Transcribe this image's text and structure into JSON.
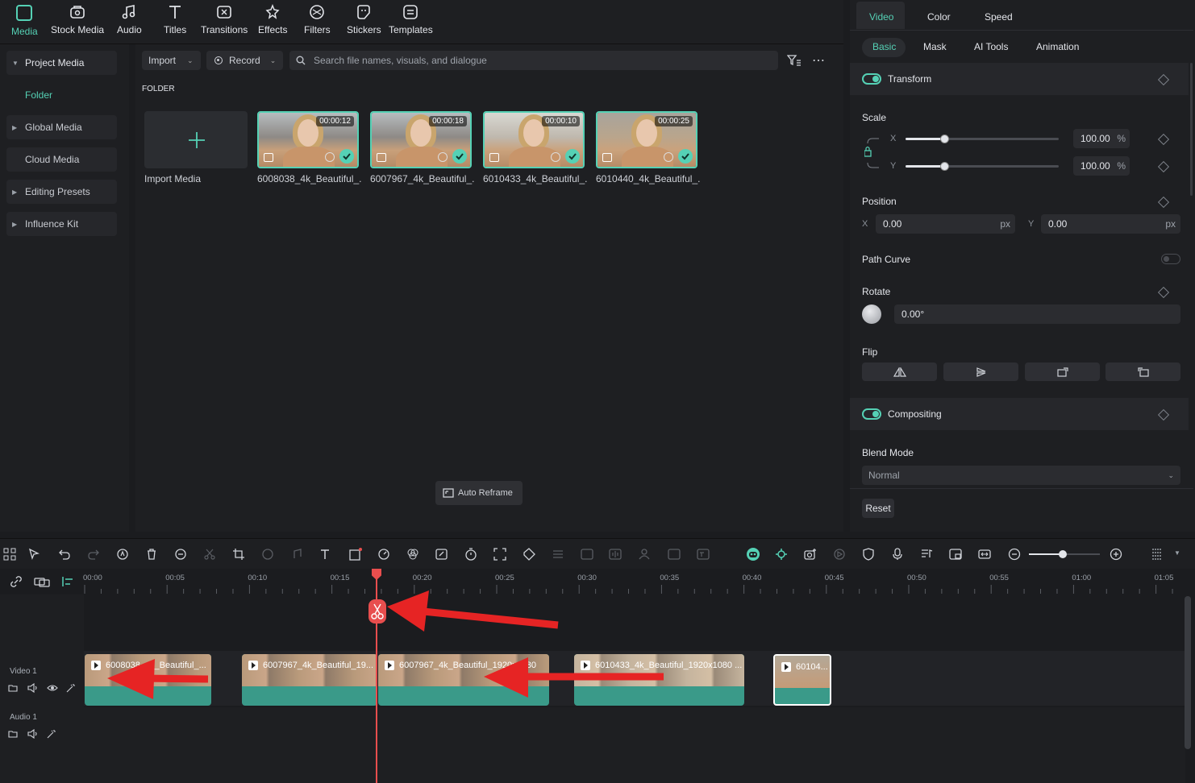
{
  "topbar": {
    "items": [
      {
        "label": "Media",
        "icon": "media-icon",
        "active": true
      },
      {
        "label": "Stock Media",
        "icon": "stock-media-icon"
      },
      {
        "label": "Audio",
        "icon": "music-note-icon"
      },
      {
        "label": "Titles",
        "icon": "text-t-icon"
      },
      {
        "label": "Transitions",
        "icon": "transitions-icon"
      },
      {
        "label": "Effects",
        "icon": "effects-icon"
      },
      {
        "label": "Filters",
        "icon": "filters-icon"
      },
      {
        "label": "Stickers",
        "icon": "stickers-icon"
      },
      {
        "label": "Templates",
        "icon": "templates-icon"
      }
    ]
  },
  "sidebar": {
    "items": [
      {
        "label": "Project Media",
        "expanded": true
      },
      {
        "label": "Folder"
      },
      {
        "label": "Global Media"
      },
      {
        "label": "Cloud Media"
      },
      {
        "label": "Editing Presets"
      },
      {
        "label": "Influence Kit"
      }
    ]
  },
  "media": {
    "import_label": "Import",
    "record_label": "Record",
    "search_placeholder": "Search file names, visuals, and dialogue",
    "folder_heading": "FOLDER",
    "import_tile_label": "Import Media",
    "auto_reframe_label": "Auto Reframe",
    "clips": [
      {
        "name": "6008038_4k_Beautiful_...",
        "duration": "00:00:12"
      },
      {
        "name": "6007967_4k_Beautiful_...",
        "duration": "00:00:18"
      },
      {
        "name": "6010433_4k_Beautiful_...",
        "duration": "00:00:10"
      },
      {
        "name": "6010440_4k_Beautiful_...",
        "duration": "00:00:25"
      }
    ]
  },
  "panel": {
    "tabs": [
      "Video",
      "Color",
      "Speed"
    ],
    "active_tab": "Video",
    "subtabs": [
      "Basic",
      "Mask",
      "AI Tools",
      "Animation"
    ],
    "active_subtab": "Basic",
    "transform": {
      "title": "Transform",
      "scale_label": "Scale",
      "scale_x_label": "X",
      "scale_y_label": "Y",
      "scale_x": "100.00",
      "scale_y": "100.00",
      "percent": "%",
      "scale_level": 0.25,
      "position_label": "Position",
      "pos_x_label": "X",
      "pos_y_label": "Y",
      "pos_x": "0.00",
      "pos_y": "0.00",
      "px": "px",
      "path_curve_label": "Path Curve",
      "rotate_label": "Rotate",
      "rotate_value": "0.00°",
      "flip_label": "Flip"
    },
    "compositing": {
      "title": "Compositing",
      "blend_mode_label": "Blend Mode",
      "blend_mode_value": "Normal"
    },
    "reset_label": "Reset"
  },
  "timeline": {
    "ruler_labels": [
      "00:00",
      "00:05",
      "00:10",
      "00:15",
      "00:20",
      "00:25",
      "00:30",
      "00:35",
      "00:40",
      "00:45",
      "00:50",
      "00:55",
      "01:00",
      "01:05"
    ],
    "video_track_label": "Video 1",
    "audio_track_label": "Audio 1",
    "clips": [
      {
        "name": "6008038_4k_Beautiful_..."
      },
      {
        "name": "6007967_4k_Beautiful_19..."
      },
      {
        "name": "6007967_4k_Beautiful_1920x1080"
      },
      {
        "name": "6010433_4k_Beautiful_1920x1080 ..."
      },
      {
        "name": "60104..."
      }
    ]
  },
  "colors": {
    "accent": "#55d1b5",
    "playhead": "#e84e4e",
    "arrow": "#e62424"
  }
}
